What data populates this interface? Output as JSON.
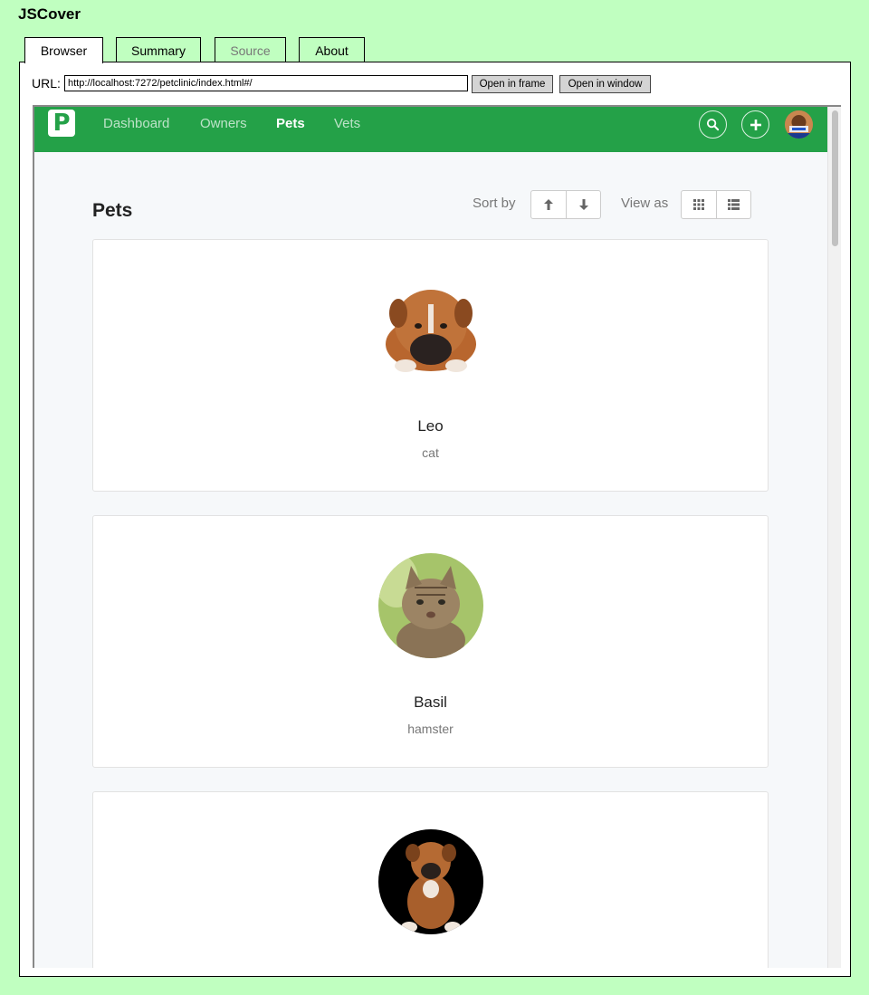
{
  "app": {
    "title": "JSCover"
  },
  "tabs": [
    {
      "label": "Browser"
    },
    {
      "label": "Summary"
    },
    {
      "label": "Source"
    },
    {
      "label": "About"
    }
  ],
  "url_bar": {
    "label": "URL:",
    "value": "http://localhost:7272/petclinic/index.html#/",
    "open_frame": "Open in frame",
    "open_window": "Open in window"
  },
  "petclinic": {
    "logo": "P",
    "nav": [
      "Dashboard",
      "Owners",
      "Pets",
      "Vets"
    ],
    "active_nav": "Pets",
    "brand_color": "#24a148",
    "icons": [
      "search-icon",
      "plus-icon",
      "user-avatar"
    ],
    "page_title": "Pets",
    "sort_label": "Sort by",
    "view_label": "View as",
    "pets": [
      {
        "name": "Leo",
        "type": "cat"
      },
      {
        "name": "Basil",
        "type": "hamster"
      },
      {
        "name": "",
        "type": ""
      }
    ]
  }
}
